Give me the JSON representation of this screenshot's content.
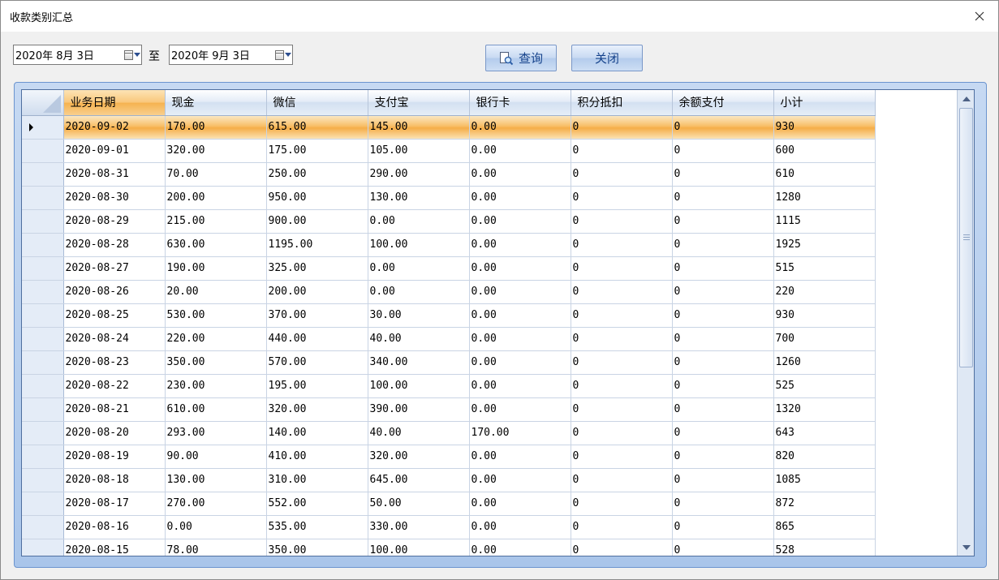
{
  "window": {
    "title": "收款类别汇总"
  },
  "filter": {
    "start_date": "2020年 8月 3日",
    "to_label": "至",
    "end_date": "2020年 9月 3日"
  },
  "buttons": {
    "query": "查询",
    "close": "关闭"
  },
  "table": {
    "columns": [
      "业务日期",
      "现金",
      "微信",
      "支付宝",
      "银行卡",
      "积分抵扣",
      "余额支付",
      "小计"
    ],
    "sorted_column": 0,
    "selected_row": 0,
    "rows": [
      [
        "2020-09-02",
        "170.00",
        "615.00",
        "145.00",
        "0.00",
        "0",
        "0",
        "930"
      ],
      [
        "2020-09-01",
        "320.00",
        "175.00",
        "105.00",
        "0.00",
        "0",
        "0",
        "600"
      ],
      [
        "2020-08-31",
        "70.00",
        "250.00",
        "290.00",
        "0.00",
        "0",
        "0",
        "610"
      ],
      [
        "2020-08-30",
        "200.00",
        "950.00",
        "130.00",
        "0.00",
        "0",
        "0",
        "1280"
      ],
      [
        "2020-08-29",
        "215.00",
        "900.00",
        "0.00",
        "0.00",
        "0",
        "0",
        "1115"
      ],
      [
        "2020-08-28",
        "630.00",
        "1195.00",
        "100.00",
        "0.00",
        "0",
        "0",
        "1925"
      ],
      [
        "2020-08-27",
        "190.00",
        "325.00",
        "0.00",
        "0.00",
        "0",
        "0",
        "515"
      ],
      [
        "2020-08-26",
        "20.00",
        "200.00",
        "0.00",
        "0.00",
        "0",
        "0",
        "220"
      ],
      [
        "2020-08-25",
        "530.00",
        "370.00",
        "30.00",
        "0.00",
        "0",
        "0",
        "930"
      ],
      [
        "2020-08-24",
        "220.00",
        "440.00",
        "40.00",
        "0.00",
        "0",
        "0",
        "700"
      ],
      [
        "2020-08-23",
        "350.00",
        "570.00",
        "340.00",
        "0.00",
        "0",
        "0",
        "1260"
      ],
      [
        "2020-08-22",
        "230.00",
        "195.00",
        "100.00",
        "0.00",
        "0",
        "0",
        "525"
      ],
      [
        "2020-08-21",
        "610.00",
        "320.00",
        "390.00",
        "0.00",
        "0",
        "0",
        "1320"
      ],
      [
        "2020-08-20",
        "293.00",
        "140.00",
        "40.00",
        "170.00",
        "0",
        "0",
        "643"
      ],
      [
        "2020-08-19",
        "90.00",
        "410.00",
        "320.00",
        "0.00",
        "0",
        "0",
        "820"
      ],
      [
        "2020-08-18",
        "130.00",
        "310.00",
        "645.00",
        "0.00",
        "0",
        "0",
        "1085"
      ],
      [
        "2020-08-17",
        "270.00",
        "552.00",
        "50.00",
        "0.00",
        "0",
        "0",
        "872"
      ],
      [
        "2020-08-16",
        "0.00",
        "535.00",
        "330.00",
        "0.00",
        "0",
        "0",
        "865"
      ],
      [
        "2020-08-15",
        "78.00",
        "350.00",
        "100.00",
        "0.00",
        "0",
        "0",
        "528"
      ]
    ]
  },
  "icons": {
    "close": "close-icon",
    "calendar": "calendar-icon",
    "query": "search-document-icon",
    "row_indicator": "current-row-indicator-icon"
  },
  "colors": {
    "selected_row": "#f8c06a",
    "sorted_header": "#f9c67a",
    "panel_background": "#b5cdee",
    "button_text": "#15428b"
  }
}
